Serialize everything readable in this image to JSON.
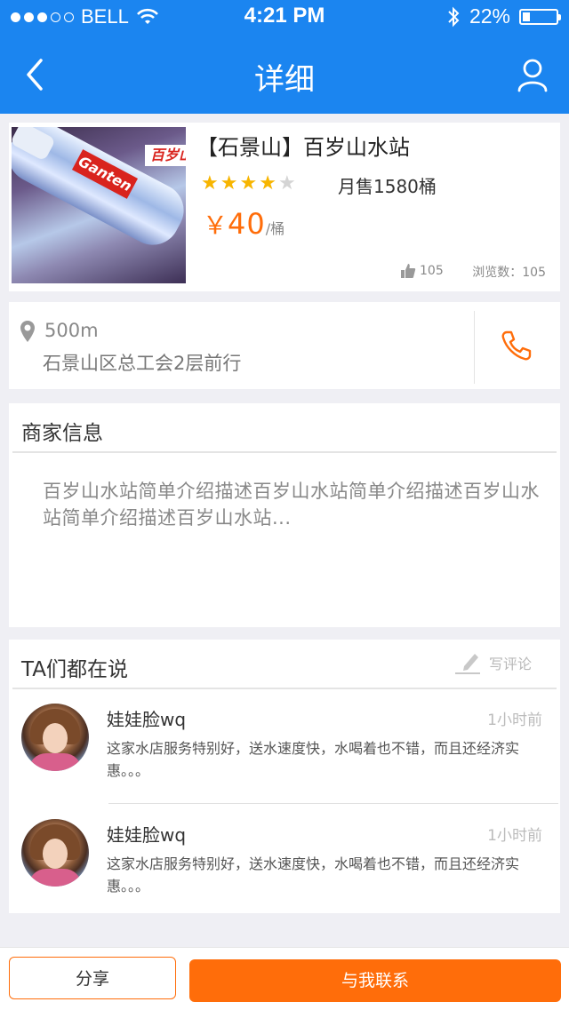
{
  "status_bar": {
    "carrier": "BELL",
    "signal_full": 3,
    "signal_total": 5,
    "time": "4:21 PM",
    "battery_text": "22%",
    "battery_level": 0.22
  },
  "nav": {
    "title": "详细",
    "back_icon": "chevron-left-icon",
    "user_icon": "user-icon"
  },
  "product": {
    "name": "【石景山】百岁山水站",
    "rating": 4,
    "rating_max": 5,
    "monthly_sales": "月售1580桶",
    "price_symbol": "￥",
    "price": "40",
    "price_unit": "/桶",
    "likes": "105",
    "views": "浏览数：105",
    "image_brand_label": "百岁山",
    "image_brand_en": "Ganten"
  },
  "location": {
    "distance": "500m",
    "address": "石景山区总工会2层前行"
  },
  "merchant": {
    "title": "商家信息",
    "description": "百岁山水站简单介绍描述百岁山水站简单介绍描述百岁山水站简单介绍描述百岁山水站..."
  },
  "reviews": {
    "title": "TA们都在说",
    "write_label": "写评论",
    "items": [
      {
        "name": "娃娃脸wq",
        "time": "1小时前",
        "text": "这家水店服务特别好，送水速度快，水喝着也不错，而且还经济实惠。。。"
      },
      {
        "name": "娃娃脸wq",
        "time": "1小时前",
        "text": "这家水店服务特别好，送水速度快，水喝着也不错，而且还经济实惠。。。"
      }
    ]
  },
  "actions": {
    "share_label": "分享",
    "contact_label": "与我联系"
  },
  "colors": {
    "header_blue": "#1b85f0",
    "accent_orange": "#ff6d0a",
    "star_gold": "#f7b500"
  }
}
